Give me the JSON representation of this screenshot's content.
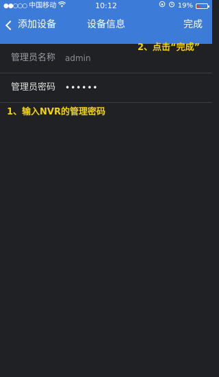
{
  "status_bar": {
    "signal": "●●○○○",
    "carrier": "中国移动",
    "wifi_icon": "wifi-icon",
    "time": "10:12",
    "battery_percent": "19%"
  },
  "nav": {
    "back_label": "添加设备",
    "title": "设备信息",
    "done_label": "完成"
  },
  "form": {
    "rows": [
      {
        "label": "管理员名称",
        "value": "admin"
      },
      {
        "label": "管理员密码",
        "value": "••••••"
      }
    ]
  },
  "annotations": {
    "step1": "1、输入NVR的管理密码",
    "step2": "2、点击“完成”"
  },
  "colors": {
    "nav_bg": "#3d7bd8",
    "page_bg": "#1f2125",
    "annotation": "#f5d400"
  }
}
